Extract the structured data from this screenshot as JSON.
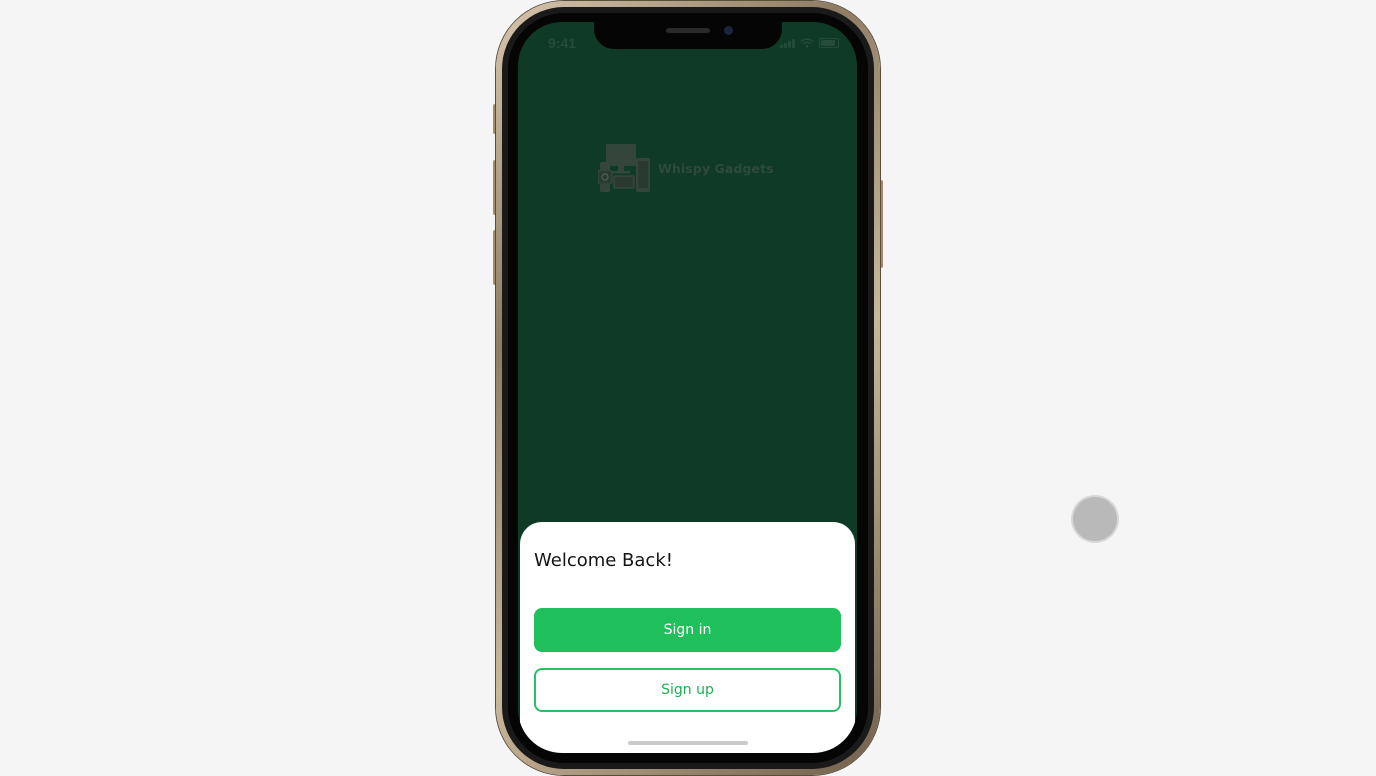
{
  "status_bar": {
    "time": "9:41",
    "signal_icon": "signal-icon",
    "wifi_icon": "wifi-icon",
    "battery_icon": "battery-icon"
  },
  "logo": {
    "text": "Whispy Gadgets",
    "icon": "gadgets-logo-icon"
  },
  "sheet": {
    "title": "Welcome Back!",
    "primary_button": "Sign in",
    "secondary_button": "Sign up"
  },
  "colors": {
    "background": "#0f3a26",
    "accent": "#1fbf5c",
    "sheet": "#ffffff"
  }
}
